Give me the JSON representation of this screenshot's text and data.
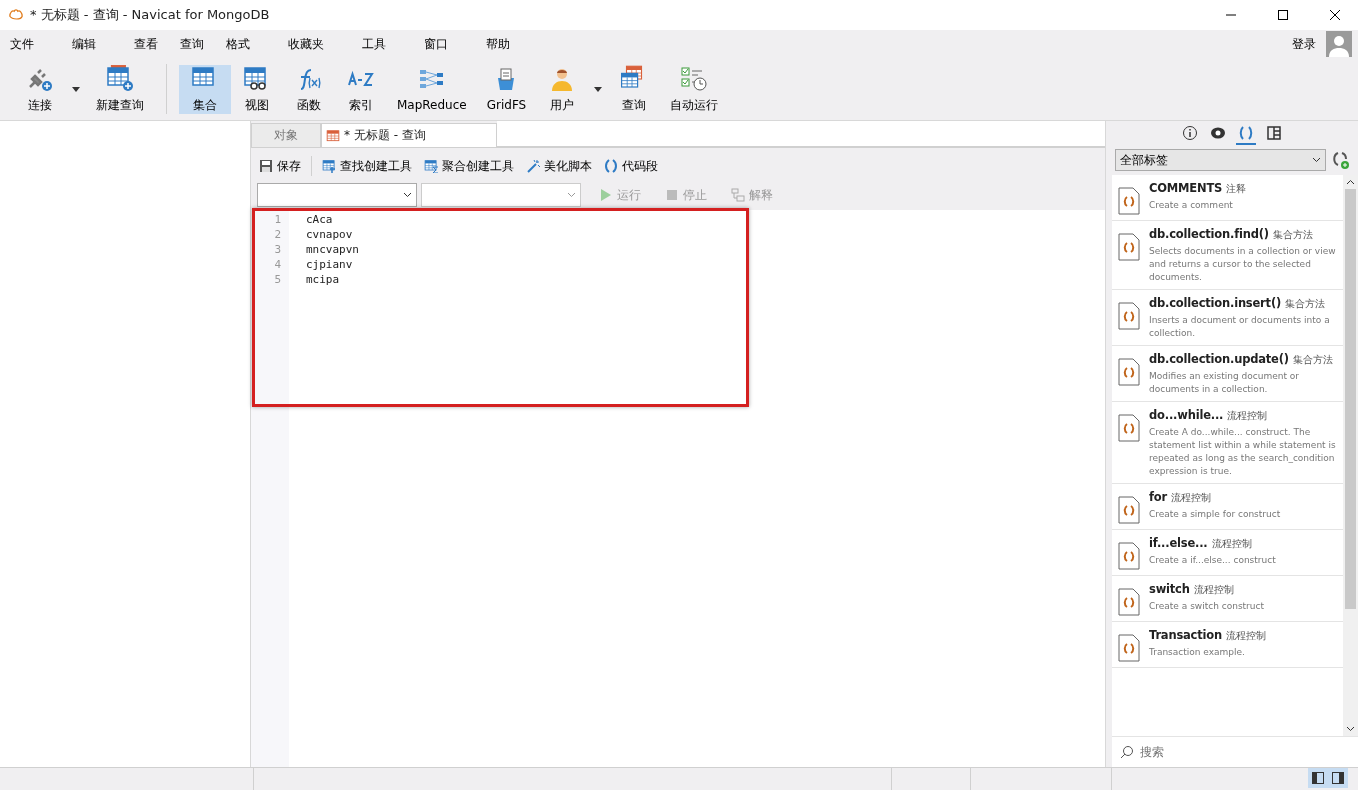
{
  "window": {
    "title": "* 无标题 - 查询 - Navicat for MongoDB"
  },
  "menu": [
    "文件",
    "编辑",
    "查看",
    "查询",
    "格式",
    "收藏夹",
    "工具",
    "窗口",
    "帮助"
  ],
  "login": "登录",
  "toolbar": [
    {
      "label": "连接",
      "selected": false,
      "has_menu": true
    },
    {
      "label": "新建查询",
      "selected": false,
      "has_menu": false
    },
    {
      "label": "集合",
      "selected": true,
      "has_menu": false
    },
    {
      "label": "视图",
      "selected": false,
      "has_menu": false
    },
    {
      "label": "函数",
      "selected": false,
      "has_menu": false
    },
    {
      "label": "索引",
      "selected": false,
      "has_menu": false
    },
    {
      "label": "MapReduce",
      "selected": false,
      "has_menu": false
    },
    {
      "label": "GridFS",
      "selected": false,
      "has_menu": false
    },
    {
      "label": "用户",
      "selected": false,
      "has_menu": true
    },
    {
      "label": "查询",
      "selected": false,
      "has_menu": false
    },
    {
      "label": "自动运行",
      "selected": false,
      "has_menu": false
    }
  ],
  "tabs": [
    {
      "label": "对象",
      "selected": false
    },
    {
      "label": "* 无标题 - 查询",
      "selected": true
    }
  ],
  "query_toolbar": [
    "保存",
    "查找创建工具",
    "聚合创建工具",
    "美化脚本",
    "代码段"
  ],
  "run_controls": [
    {
      "label": "运行",
      "disabled": true
    },
    {
      "label": "停止",
      "disabled": true
    },
    {
      "label": "解释",
      "disabled": true
    }
  ],
  "editor": {
    "lines": [
      {
        "number": "1",
        "code": "cAca"
      },
      {
        "number": "2",
        "code": "cvnapov"
      },
      {
        "number": "3",
        "code": "mncvapvn"
      },
      {
        "number": "4",
        "code": "cjpianv"
      },
      {
        "number": "5",
        "code": "mcipa"
      }
    ]
  },
  "snippet_panel": {
    "tabs": [
      {
        "selected": false
      },
      {
        "selected": false
      },
      {
        "selected": true
      },
      {
        "selected": false
      }
    ],
    "filter": "全部标签",
    "snippets": [
      {
        "title": "COMMENTS",
        "tag": "注释",
        "description": "Create a comment"
      },
      {
        "title": "db.collection.find()",
        "tag": "集合方法",
        "description": "Selects documents in a collection or view and returns a cursor to the selected documents."
      },
      {
        "title": "db.collection.insert()",
        "tag": "集合方法",
        "description": "Inserts a document or documents into a collection."
      },
      {
        "title": "db.collection.update()",
        "tag": "集合方法",
        "description": "Modifies an existing document or documents in a collection."
      },
      {
        "title": "do...while...",
        "tag": "流程控制",
        "description": "Create A do...while... construct. The statement list within a while statement is repeated as long as the search_condition expression is true."
      },
      {
        "title": "for",
        "tag": "流程控制",
        "description": "Create a simple for construct"
      },
      {
        "title": "if...else...",
        "tag": "流程控制",
        "description": "Create a if...else... construct"
      },
      {
        "title": "switch",
        "tag": "流程控制",
        "description": "Create a switch construct"
      },
      {
        "title": "Transaction",
        "tag": "流程控制",
        "description": "Transaction example."
      }
    ],
    "search_placeholder": "搜索"
  }
}
